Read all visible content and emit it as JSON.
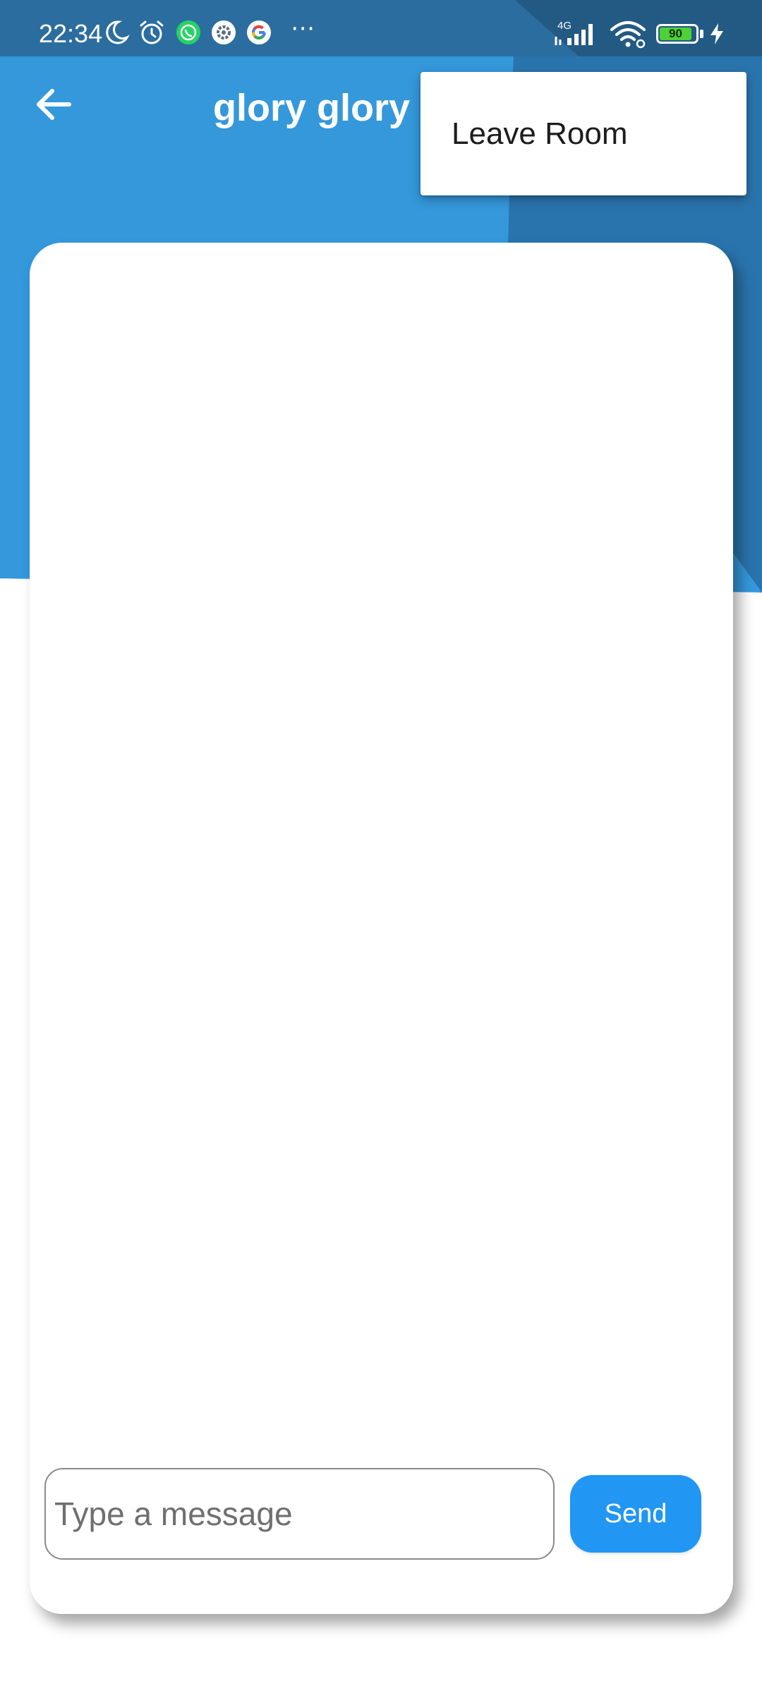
{
  "status_bar": {
    "time": "22:34",
    "network_label": "4G",
    "battery_level": "90",
    "icons": [
      "moon-icon",
      "alarm-icon",
      "whatsapp-icon",
      "settings-app-icon",
      "google-icon",
      "more-dots-icon",
      "signal-icon",
      "wifi-icon",
      "battery-icon",
      "charging-bolt-icon"
    ]
  },
  "app_bar": {
    "title": "glory glory m",
    "back_icon": "arrow-left-icon"
  },
  "menu": {
    "items": [
      {
        "label": "Leave Room"
      }
    ]
  },
  "composer": {
    "placeholder": "Type a message",
    "value": "",
    "send_label": "Send"
  },
  "colors": {
    "primary_blue": "#3498db",
    "dark_blue": "#2a74ad",
    "status_blue": "#2c6d9f",
    "send_button": "#2196f3",
    "battery_green": "#4cd137"
  }
}
